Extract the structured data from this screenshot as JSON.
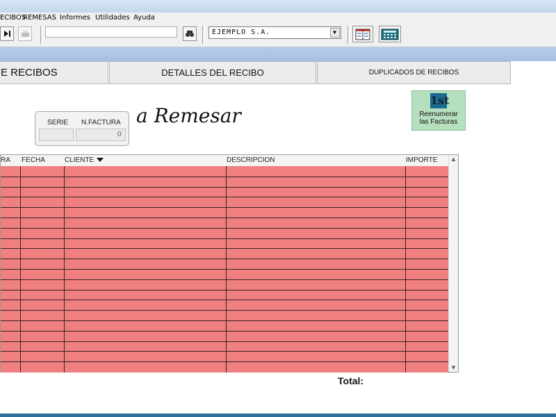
{
  "menu": [
    "ECIBOS",
    "REMESAS",
    "Informes",
    "Utilidades",
    "Ayuda"
  ],
  "toolbar": {
    "search_value": "",
    "company": "EJEMPLO S.A.",
    "icons": [
      "last-record-icon",
      "print-icon",
      "binoculars-icon",
      "calendar-icon",
      "calculator-icon"
    ]
  },
  "tabs": [
    "E RECIBOS",
    "DETALLES DEL RECIBO",
    "DUPLICADOS DE RECIBOS"
  ],
  "filter": {
    "serie_label": "SERIE",
    "factura_label": "N.FACTURA",
    "serie_value": "",
    "factura_value": "0",
    "heading": "a Remesar"
  },
  "renumber_button": {
    "badge": "1st",
    "line1": "Reenumerar",
    "line2": "las Facturas"
  },
  "grid": {
    "columns": [
      "RA",
      "FECHA",
      "CLIENTE",
      "DESCRIPCION",
      "IMPORTE"
    ],
    "sort_column": "CLIENTE",
    "row_color": "#f08080"
  },
  "footer": {
    "total_label": "Total:"
  }
}
